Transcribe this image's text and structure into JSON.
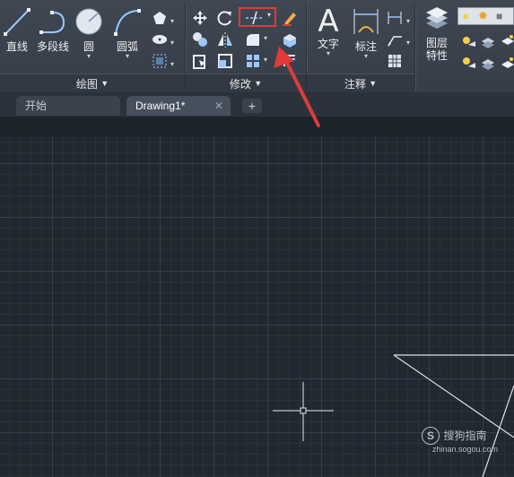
{
  "ribbon": {
    "draw": {
      "line": "直线",
      "polyline": "多段线",
      "circle": "圆",
      "arc": "圆弧",
      "panel_title": "绘图"
    },
    "modify": {
      "panel_title": "修改"
    },
    "annotation": {
      "text": "文字",
      "dimension": "标注",
      "panel_title": "注释"
    },
    "layers": {
      "properties_line1": "图层",
      "properties_line2": "特性"
    }
  },
  "tabs": [
    {
      "label": "开始"
    },
    {
      "label": "Drawing1*"
    }
  ],
  "watermark": {
    "site": "搜狗指南",
    "url": "zhinan.sogou.com"
  },
  "colors": {
    "highlight": "#e03a3a",
    "canvas": "#212830",
    "ribbon": "#3b4350"
  }
}
